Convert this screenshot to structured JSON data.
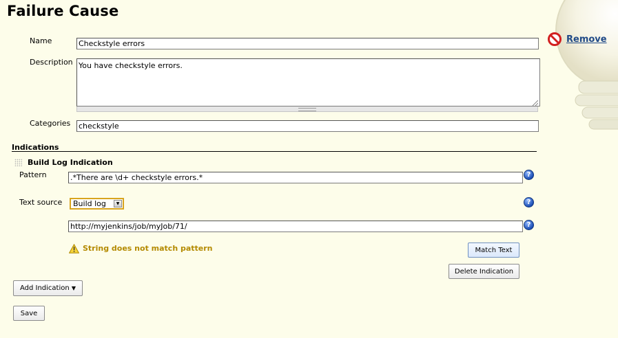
{
  "page": {
    "title": "Failure Cause"
  },
  "remove": {
    "label": "Remove",
    "icon": "no-entry-icon"
  },
  "form": {
    "name_label": "Name",
    "name_value": "Checkstyle errors",
    "description_label": "Description",
    "description_value": "You have checkstyle errors.",
    "categories_label": "Categories",
    "categories_value": "checkstyle"
  },
  "indications": {
    "section_title": "Indications",
    "item_title": "Build Log Indication",
    "pattern_label": "Pattern",
    "pattern_value": ".*There are \\d+ checkstyle errors.*",
    "text_source_label": "Text source",
    "text_source_selected": "Build log",
    "url_value": "http://myjenkins/job/myJob/71/",
    "warning_text": "String does not match pattern",
    "match_text_label": "Match Text",
    "delete_label": "Delete Indication",
    "help_glyph": "?"
  },
  "actions": {
    "add_indication_label": "Add Indication",
    "add_indication_arrow": "▼",
    "save_label": "Save"
  },
  "colors": {
    "background": "#fdfdea",
    "warning": "#b48a00",
    "link": "#204a87",
    "select_focus": "#d8a41e"
  }
}
